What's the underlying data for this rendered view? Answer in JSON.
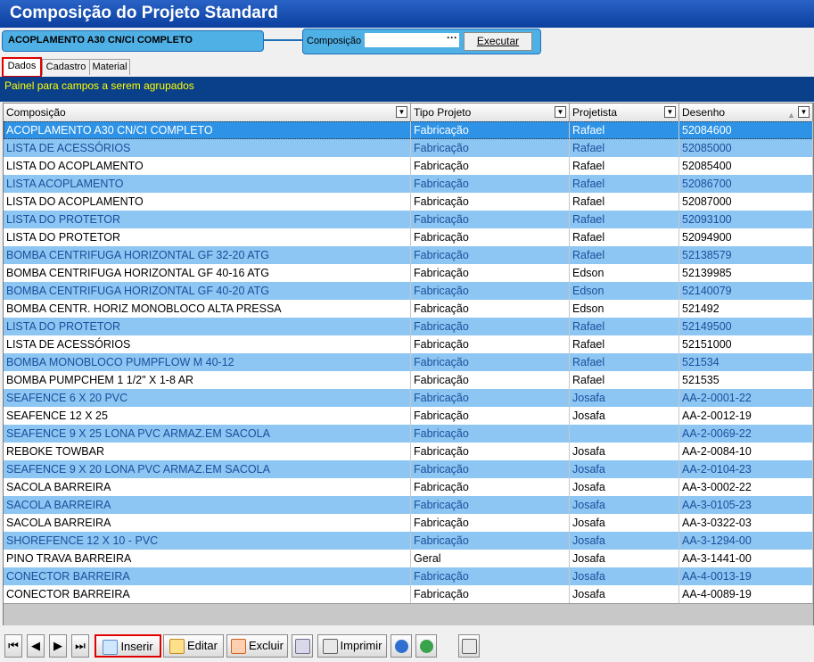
{
  "window": {
    "title": "Composição do Projeto Standard"
  },
  "project_bar": {
    "label": "ACOPLAMENTO A30 CN/CI COMPLETO"
  },
  "composicao": {
    "label": "Composição",
    "value": "",
    "lookup": "···",
    "execute": "Executar"
  },
  "tabs": [
    {
      "label": "Dados"
    },
    {
      "label": "Cadastro"
    },
    {
      "label": "Material"
    }
  ],
  "panel": {
    "text": "Painel para campos a serem agrupados"
  },
  "table": {
    "headers": [
      "Composição",
      "Tipo Projeto",
      "Projetista",
      "Desenho"
    ],
    "rows": [
      [
        "ACOPLAMENTO A30 CN/CI COMPLETO",
        "Fabricação",
        "Rafael",
        "52084600"
      ],
      [
        "LISTA DE ACESSÓRIOS",
        "Fabricação",
        "Rafael",
        "52085000"
      ],
      [
        "LISTA DO ACOPLAMENTO",
        "Fabricação",
        "Rafael",
        "52085400"
      ],
      [
        "LISTA ACOPLAMENTO",
        "Fabricação",
        "Rafael",
        "52086700"
      ],
      [
        "LISTA DO ACOPLAMENTO",
        "Fabricação",
        "Rafael",
        "52087000"
      ],
      [
        "LISTA DO PROTETOR",
        "Fabricação",
        "Rafael",
        "52093100"
      ],
      [
        "LISTA DO PROTETOR",
        "Fabricação",
        "Rafael",
        "52094900"
      ],
      [
        "BOMBA CENTRIFUGA HORIZONTAL GF 32-20 ATG",
        "Fabricação",
        "Rafael",
        "52138579"
      ],
      [
        "BOMBA CENTRIFUGA HORIZONTAL GF 40-16 ATG",
        "Fabricação",
        "Edson",
        "52139985"
      ],
      [
        "BOMBA CENTRIFUGA HORIZONTAL GF 40-20 ATG",
        "Fabricação",
        "Edson",
        "52140079"
      ],
      [
        "BOMBA CENTR. HORIZ MONOBLOCO ALTA PRESSA",
        "Fabricação",
        "Edson",
        "521492"
      ],
      [
        "LISTA DO PROTETOR",
        "Fabricação",
        "Rafael",
        "52149500"
      ],
      [
        "LISTA DE ACESSÓRIOS",
        "Fabricação",
        "Rafael",
        "52151000"
      ],
      [
        "BOMBA MONOBLOCO PUMPFLOW M 40-12",
        "Fabricação",
        "Rafael",
        "521534"
      ],
      [
        "BOMBA PUMPCHEM 1 1/2\" X 1-8 AR",
        "Fabricação",
        "Rafael",
        "521535"
      ],
      [
        "SEAFENCE 6 X 20 PVC",
        "Fabricação",
        "Josafa",
        "AA-2-0001-22"
      ],
      [
        "SEAFENCE 12 X 25",
        "Fabricação",
        "Josafa",
        "AA-2-0012-19"
      ],
      [
        "SEAFENCE 9 X 25 LONA PVC ARMAZ.EM SACOLA",
        "Fabricação",
        "",
        "AA-2-0069-22"
      ],
      [
        "REBOKE TOWBAR",
        "Fabricação",
        "Josafa",
        "AA-2-0084-10"
      ],
      [
        "SEAFENCE 9 X 20 LONA PVC ARMAZ.EM SACOLA",
        "Fabricação",
        "Josafa",
        "AA-2-0104-23"
      ],
      [
        "SACOLA BARREIRA",
        "Fabricação",
        "Josafa",
        "AA-3-0002-22"
      ],
      [
        "SACOLA BARREIRA",
        "Fabricação",
        "Josafa",
        "AA-3-0105-23"
      ],
      [
        "SACOLA BARREIRA",
        "Fabricação",
        "Josafa",
        "AA-3-0322-03"
      ],
      [
        "SHOREFENCE 12 X 10 - PVC",
        "Fabricação",
        "Josafa",
        "AA-3-1294-00"
      ],
      [
        "PINO TRAVA BARREIRA",
        "Geral",
        "Josafa",
        "AA-3-1441-00"
      ],
      [
        "CONECTOR BARREIRA",
        "Fabricação",
        "Josafa",
        "AA-4-0013-19"
      ],
      [
        "CONECTOR BARREIRA",
        "Fabricação",
        "Josafa",
        "AA-4-0089-19"
      ]
    ]
  },
  "toolbar": {
    "first": "⏮",
    "prev": "◀",
    "next": "▶",
    "last": "⏭",
    "insert": "Inserir",
    "edit": "Editar",
    "delete": "Excluir",
    "print": "Imprimir"
  }
}
